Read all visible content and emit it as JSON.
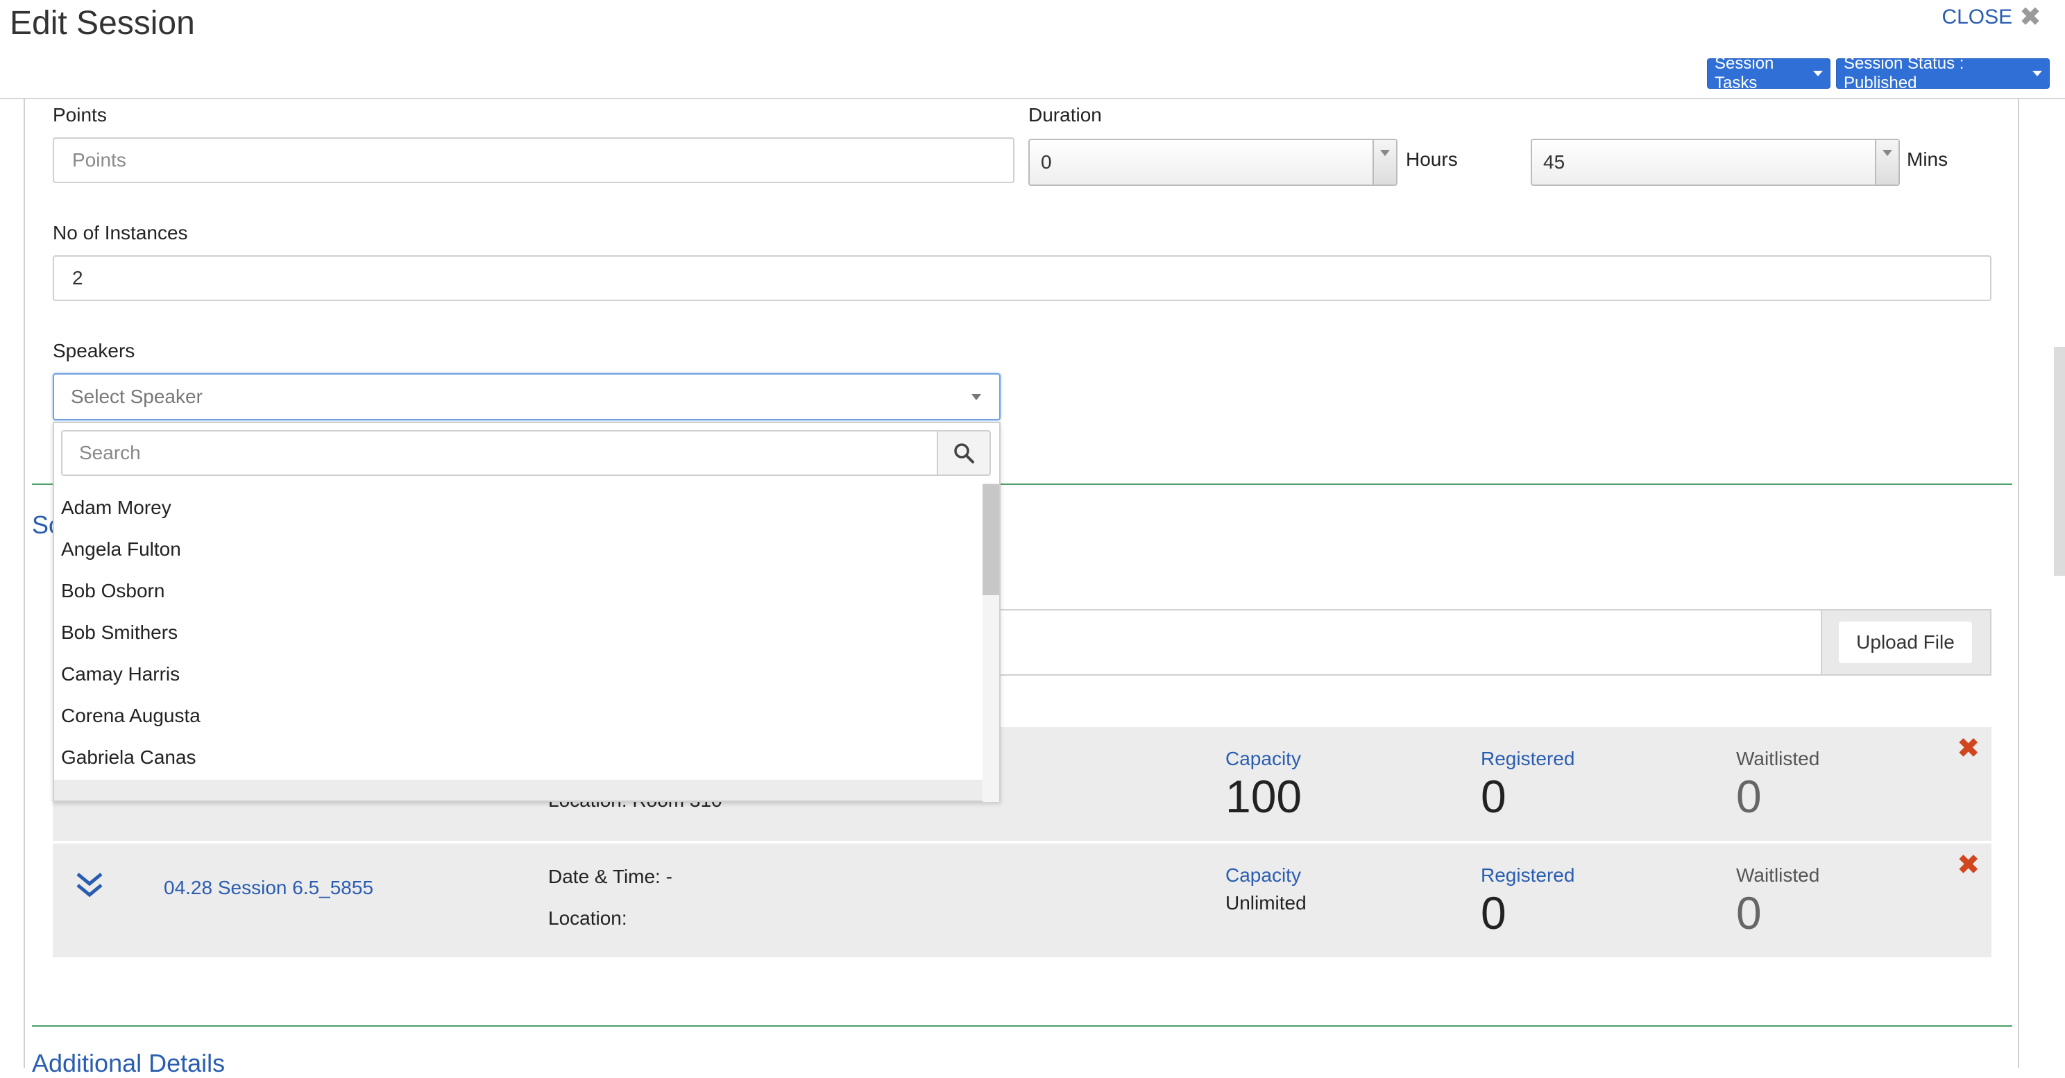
{
  "header": {
    "title": "Edit Session",
    "close_label": "CLOSE",
    "session_tasks_label": "Session Tasks",
    "session_status_label": "Session Status : Published"
  },
  "form": {
    "points_label": "Points",
    "points_placeholder": "Points",
    "duration_label": "Duration",
    "duration_hours_value": "0",
    "hours_unit": "Hours",
    "duration_mins_value": "45",
    "mins_unit": "Mins",
    "instances_label": "No of Instances",
    "instances_value": "2",
    "speakers_label": "Speakers",
    "speaker_placeholder": "Select Speaker"
  },
  "speaker_dropdown": {
    "search_placeholder": "Search",
    "items": [
      "Adam Morey",
      "Angela Fulton",
      "Bob Osborn",
      "Bob Smithers",
      "Camay Harris",
      "Corena Augusta",
      "Gabriela Canas"
    ]
  },
  "sections": {
    "partial_title": "Sc",
    "additional_details": "Additional Details"
  },
  "upload": {
    "button_label": "Upload File"
  },
  "instances": [
    {
      "location_partial": "Location: Room 310",
      "capacity_label": "Capacity",
      "capacity_value": "100",
      "registered_label": "Registered",
      "registered_value": "0",
      "waitlisted_label": "Waitlisted",
      "waitlisted_value": "0"
    },
    {
      "name": "04.28 Session 6.5_5855",
      "datetime": "Date & Time: -",
      "location": "Location:",
      "capacity_label": "Capacity",
      "capacity_value": "Unlimited",
      "registered_label": "Registered",
      "registered_value": "0",
      "waitlisted_label": "Waitlisted",
      "waitlisted_value": "0"
    }
  ],
  "colors": {
    "accent": "#2f6fd6",
    "link": "#2a5db0",
    "delete": "#d0461e",
    "divider": "#4aa06a"
  }
}
